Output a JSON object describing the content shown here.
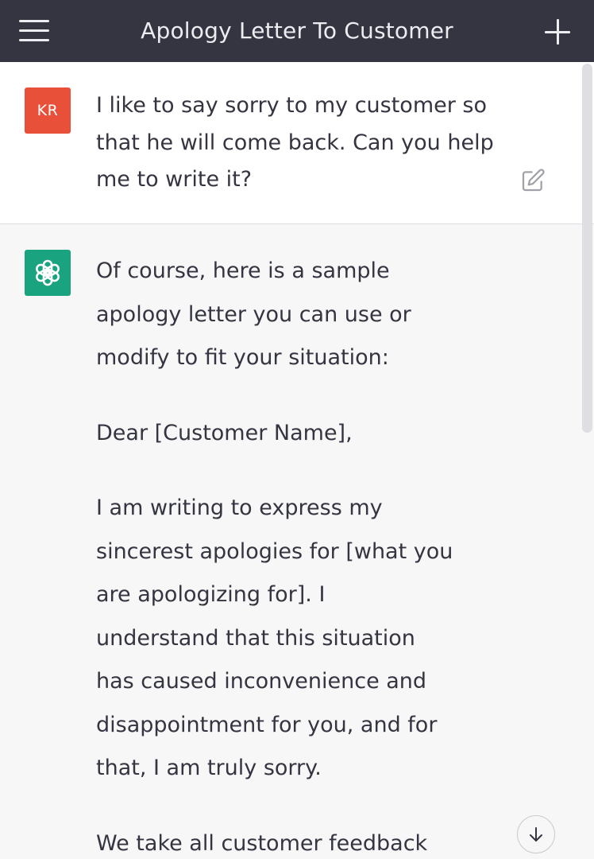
{
  "header": {
    "title": "Apology Letter To Customer",
    "menu_icon": "hamburger-menu-icon",
    "new_chat_icon": "plus-icon"
  },
  "user_message": {
    "avatar_initials": "KR",
    "avatar_color": "#e8503a",
    "text": "I like to say sorry to my customer so that he will come back. Can you help me to write it?",
    "edit_icon": "edit-icon"
  },
  "assistant_message": {
    "avatar_icon": "openai-logo-icon",
    "avatar_color": "#19a37f",
    "paragraphs": [
      "Of course, here is a sample apology letter you can use or modify to fit your situation:",
      "Dear [Customer Name],",
      "I am writing to express my sincerest apologies for [what you are apologizing for]. I understand that this situation has caused inconvenience and disappointment for you, and for that, I am truly sorry.",
      "We take all customer feedback"
    ]
  },
  "scroll_down_icon": "arrow-down-icon",
  "colors": {
    "header_bg": "#343541",
    "user_bg": "#ffffff",
    "assistant_bg": "#f7f7f8",
    "text": "#343541"
  }
}
